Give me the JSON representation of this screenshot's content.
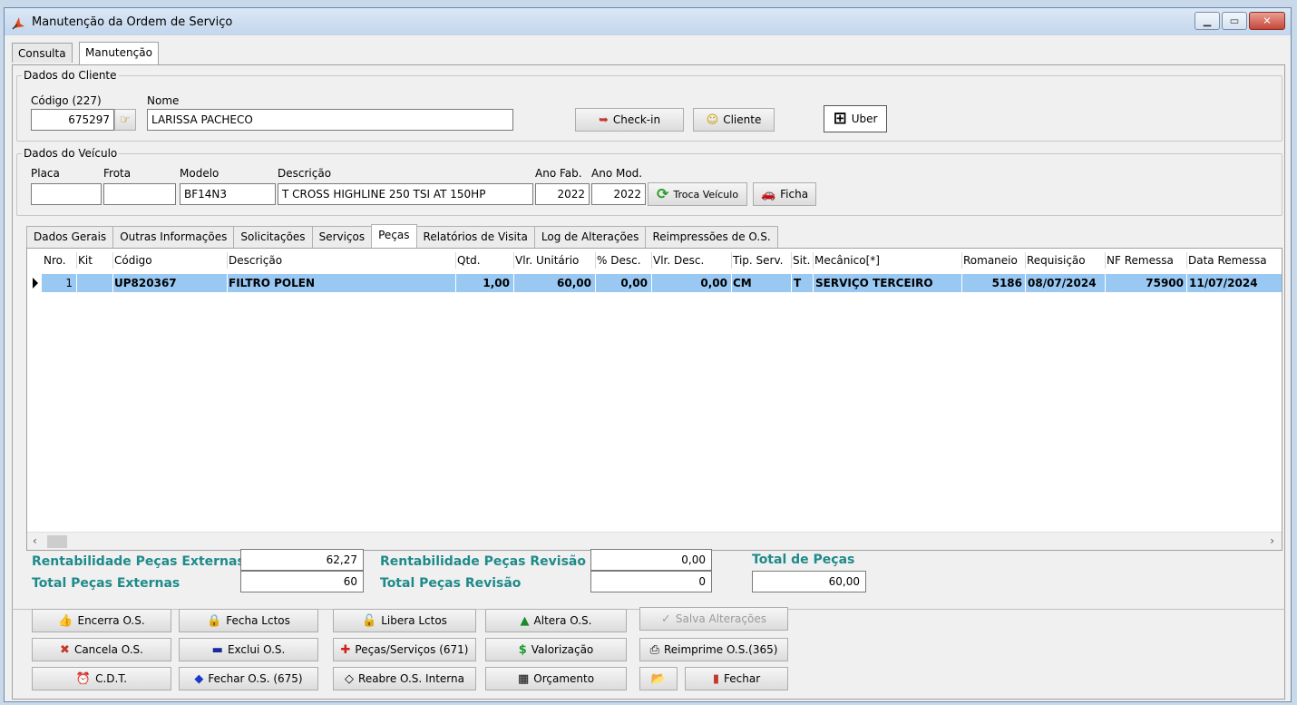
{
  "window": {
    "title": "Manutenção da Ordem de Serviço"
  },
  "top_tabs": [
    {
      "label": "Consulta"
    },
    {
      "label": "Manutenção"
    }
  ],
  "cliente": {
    "group": "Dados do Cliente",
    "codigo_label": "Código (227)",
    "codigo_value": "675297",
    "nome_label": "Nome",
    "nome_value": "LARISSA PACHECO",
    "checkin_label": "Check-in",
    "cliente_label": "Cliente",
    "uber_label": "Uber"
  },
  "veiculo": {
    "group": "Dados do Veículo",
    "placa_label": "Placa",
    "placa_value": "",
    "frota_label": "Frota",
    "frota_value": "",
    "modelo_label": "Modelo",
    "modelo_value": "BF14N3",
    "descricao_label": "Descrição",
    "descricao_value": "T CROSS HIGHLINE 250 TSI AT 150HP",
    "ano_fab_label": "Ano Fab.",
    "ano_fab_value": "2022",
    "ano_mod_label": "Ano Mod.",
    "ano_mod_value": "2022",
    "troca_label": "Troca Veículo",
    "ficha_label": "Ficha"
  },
  "inner_tabs": [
    {
      "label": "Dados Gerais"
    },
    {
      "label": "Outras Informações"
    },
    {
      "label": "Solicitações"
    },
    {
      "label": "Serviços"
    },
    {
      "label": "Peças"
    },
    {
      "label": "Relatórios de Visita"
    },
    {
      "label": "Log de Alterações"
    },
    {
      "label": "Reimpressões de O.S."
    }
  ],
  "grid": {
    "columns": [
      "Nro.",
      "Kit",
      "Código",
      "Descrição",
      "Qtd.",
      "Vlr. Unitário",
      "% Desc.",
      "Vlr. Desc.",
      "Tip. Serv.",
      "Sit.",
      "Mecânico[*]",
      "Romaneio",
      "Requisição",
      "NF Remessa",
      "Data Remessa"
    ],
    "rows": [
      {
        "nro": "1",
        "kit": "",
        "codigo": "UP820367",
        "descricao": "FILTRO POLEN",
        "qtd": "1,00",
        "vlr_unit": "60,00",
        "desc_pct": "0,00",
        "vlr_desc": "0,00",
        "tip_serv": "CM",
        "sit": "T",
        "mecanico": "SERVIÇO TERCEIRO",
        "romaneio": "5186",
        "requisicao": "08/07/2024",
        "nf_remessa": "75900",
        "data_remessa": "11/07/2024"
      }
    ]
  },
  "totais": {
    "rent_ext_label": "Rentabilidade Peças Externas",
    "rent_ext_value": "62,27",
    "total_ext_label": "Total Peças Externas",
    "total_ext_value": "60",
    "rent_rev_label": "Rentabilidade Peças Revisão",
    "rent_rev_value": "0,00",
    "total_rev_label": "Total Peças Revisão",
    "total_rev_value": "0",
    "total_pecas_label": "Total de Peças",
    "total_pecas_value": "60,00"
  },
  "actions": {
    "encerra": "Encerra O.S.",
    "fecha_lctos": "Fecha Lctos",
    "libera_lctos": "Libera Lctos",
    "altera": "Altera O.S.",
    "salva": "Salva Alterações",
    "cancela": "Cancela O.S.",
    "exclui": "Exclui O.S.",
    "pecas_servicos": "Peças/Serviços (671)",
    "valorizacao": "Valorização",
    "reimprime": "Reimprime O.S.(365)",
    "cdt": "C.D.T.",
    "fechar_os": "Fechar O.S. (675)",
    "reabre": "Reabre O.S. Interna",
    "orcamento": "Orçamento",
    "fechar": "Fechar"
  },
  "colors": {
    "accent_total": "#1f8a8a",
    "row_selected": "#99c8f2"
  }
}
